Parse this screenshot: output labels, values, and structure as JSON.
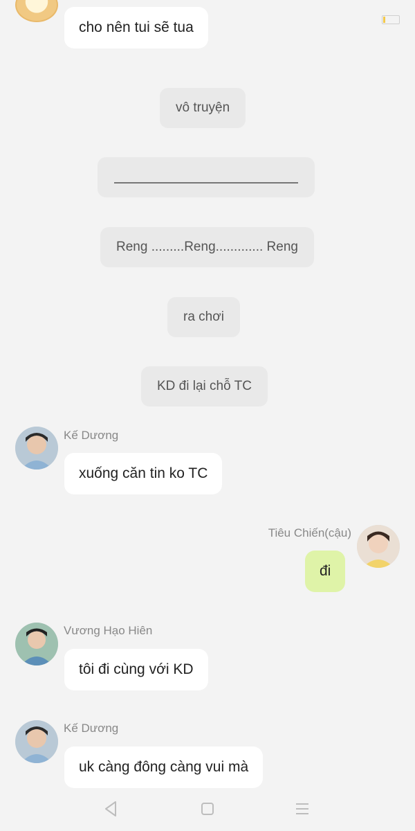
{
  "status_bar": {
    "notification_icons": [
      "facebook-icon",
      "app-icon",
      "game-icon",
      "messenger-icon",
      "google-icon"
    ]
  },
  "messages": {
    "m1": "cho nên tui sẽ tua",
    "p1": "vô truyện",
    "p3": "Reng .........Reng............. Reng",
    "p4": "ra chơi",
    "p5": "KD đi lại chỗ TC",
    "s1_name": "Kế Dương",
    "m2": "xuống căn tin ko TC",
    "s2_name": "Tiêu Chiến(cậu)",
    "m3": "đi",
    "s3_name": "Vương Hạo Hiên",
    "m4": "tôi đi cùng với KD",
    "s4_name": "Kế Dương",
    "m5": "uk càng đông càng vui mà"
  },
  "colors": {
    "background": "#f3f3f3",
    "incoming_bubble": "#ffffff",
    "outgoing_bubble": "#dff3a8",
    "narration_pill": "#e9e9e9",
    "sender_name": "#888888"
  },
  "nav_bar": {
    "back": "back-triangle-icon",
    "home": "home-square-icon",
    "menu": "menu-lines-icon"
  }
}
